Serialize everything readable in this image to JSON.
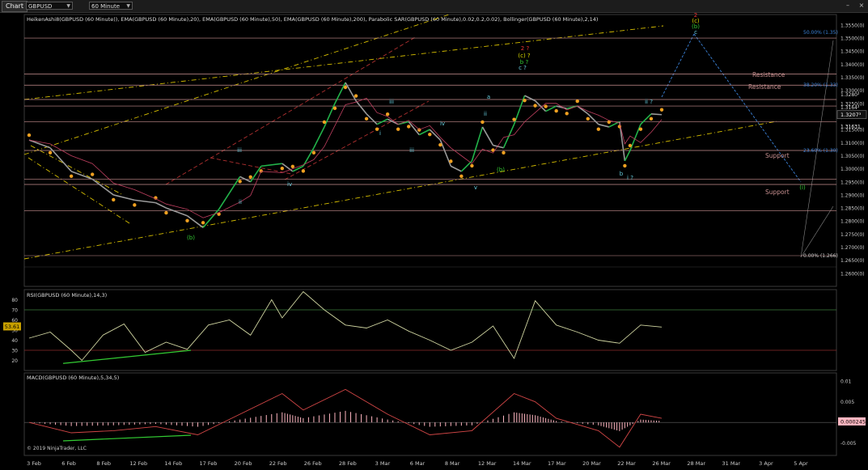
{
  "toolbar": {
    "chart_tab": "Chart",
    "instrument": "GBPUSD",
    "timeframe": "60 Minute"
  },
  "chart_data": [
    {
      "type": "line",
      "panel": "price",
      "title": "HeikenAshi8(GBPUSD (60 Minute)), EMA(GBPUSD (60 Minute),20), EMA(GBPUSD (60 Minute),50), EMA(GBPUSD (60 Minute),200), Parabolic SAR(GBPUSD (60 Minute),0.02,0.2,0.02), Bollinger(GBPUSD (60 Minute),2,14)",
      "ylim": [
        1.255,
        1.359
      ],
      "y_ticks": [
        "1.3550(0)",
        "1.3500(0)",
        "1.3450(0)",
        "1.3400(0)",
        "1.3350(0)",
        "1.3300(0)",
        "1.3250(0)",
        "1.3200(0)",
        "1.3150(0)",
        "1.3100(0)",
        "1.3050(0)",
        "1.3000(0)",
        "1.2950(0)",
        "1.2900(0)",
        "1.2850(0)",
        "1.2800(0)",
        "1.2750(0)",
        "1.2700(0)",
        "1.2650(0)",
        "1.2600(0)"
      ],
      "price_series": [
        [
          0,
          1.311
        ],
        [
          2,
          1.308
        ],
        [
          4,
          1.299
        ],
        [
          6,
          1.296
        ],
        [
          8,
          1.29
        ],
        [
          10,
          1.288
        ],
        [
          12,
          1.287
        ],
        [
          13,
          1.285
        ],
        [
          15,
          1.282
        ],
        [
          16.5,
          1.2775
        ],
        [
          18,
          1.2845
        ],
        [
          20,
          1.297
        ],
        [
          21,
          1.295
        ],
        [
          22,
          1.301
        ],
        [
          24,
          1.302
        ],
        [
          25,
          1.299
        ],
        [
          26,
          1.301
        ],
        [
          27,
          1.308
        ],
        [
          28,
          1.316
        ],
        [
          29,
          1.325
        ],
        [
          30,
          1.333
        ],
        [
          31,
          1.326
        ],
        [
          32,
          1.321
        ],
        [
          33,
          1.317
        ],
        [
          34,
          1.319
        ],
        [
          35,
          1.317
        ],
        [
          36,
          1.318
        ],
        [
          37,
          1.313
        ],
        [
          38,
          1.315
        ],
        [
          39,
          1.311
        ],
        [
          40,
          1.301
        ],
        [
          41,
          1.299
        ],
        [
          42,
          1.303
        ],
        [
          43,
          1.316
        ],
        [
          44,
          1.309
        ],
        [
          45,
          1.308
        ],
        [
          46,
          1.317
        ],
        [
          47,
          1.328
        ],
        [
          48,
          1.326
        ],
        [
          49,
          1.322
        ],
        [
          50,
          1.324
        ],
        [
          51,
          1.323
        ],
        [
          52,
          1.324
        ],
        [
          53,
          1.321
        ],
        [
          54,
          1.317
        ],
        [
          55,
          1.316
        ],
        [
          56,
          1.318
        ],
        [
          56.5,
          1.303
        ],
        [
          57,
          1.307
        ],
        [
          58,
          1.317
        ],
        [
          59,
          1.321
        ],
        [
          60,
          1.3207
        ]
      ],
      "current_price": "1.3207",
      "price_labels": [
        "1.3207³",
        "1.31631",
        "1.3280²",
        "1.3164²"
      ],
      "horizontal_levels": [
        {
          "label": "Resistance",
          "value": 1.336
        },
        {
          "label": "Resistance",
          "value": 1.333
        },
        {
          "label": "Support",
          "value": 1.3065
        },
        {
          "label": "Support",
          "value": 1.2955
        }
      ],
      "fib_labels": [
        "50.00% (1.35)",
        "38.20% (1.33)",
        "23.60% (1.30)",
        "0.00% (1.266)"
      ],
      "wave_labels": [
        "(b)",
        "iv",
        "iii",
        "ii",
        "i",
        "iii",
        "iv",
        "v",
        "a",
        "(b)",
        "2 ?",
        "(c) ?",
        "b ?",
        "c ?",
        "ii ?",
        "b",
        "i ?",
        "(i)",
        "2",
        "(c)",
        "(b)",
        "c",
        "iii",
        "ii"
      ],
      "x_tick_labels": [
        "3 Feb",
        "6 Feb",
        "8 Feb",
        "12 Feb",
        "14 Feb",
        "17 Feb",
        "20 Feb",
        "22 Feb",
        "26 Feb",
        "28 Feb",
        "3 Mar",
        "6 Mar",
        "8 Mar",
        "12 Mar",
        "14 Mar",
        "17 Mar",
        "20 Mar",
        "22 Mar",
        "26 Mar",
        "28 Mar",
        "31 Mar",
        "3 Apr",
        "5 Apr"
      ]
    },
    {
      "type": "line",
      "panel": "rsi",
      "title": "RSI(GBPUSD (60 Minute),14,3)",
      "ylim": [
        10,
        90
      ],
      "y_ticks": [
        "80",
        "70",
        "60",
        "50",
        "40",
        "30",
        "20"
      ],
      "overbought": 70,
      "oversold": 30,
      "current_value": "53.61",
      "values": [
        [
          0,
          42
        ],
        [
          2,
          48
        ],
        [
          4,
          30
        ],
        [
          5,
          20
        ],
        [
          7,
          45
        ],
        [
          9,
          56
        ],
        [
          11,
          28
        ],
        [
          13,
          38
        ],
        [
          15,
          31
        ],
        [
          17,
          55
        ],
        [
          19,
          60
        ],
        [
          21,
          45
        ],
        [
          23,
          80
        ],
        [
          24,
          62
        ],
        [
          26,
          88
        ],
        [
          28,
          70
        ],
        [
          30,
          55
        ],
        [
          32,
          52
        ],
        [
          34,
          60
        ],
        [
          36,
          49
        ],
        [
          38,
          40
        ],
        [
          40,
          30
        ],
        [
          42,
          38
        ],
        [
          44,
          54
        ],
        [
          46,
          22
        ],
        [
          48,
          79
        ],
        [
          50,
          55
        ],
        [
          52,
          48
        ],
        [
          54,
          40
        ],
        [
          56,
          37
        ],
        [
          58,
          55
        ],
        [
          60,
          53
        ]
      ]
    },
    {
      "type": "line",
      "panel": "macd",
      "title": "MACD(GBPUSD (60 Minute),5,34,5)",
      "ylim": [
        -0.008,
        0.012
      ],
      "y_ticks": [
        "0.01",
        "0.005",
        "0",
        "-0.005"
      ],
      "current_value": "0.000245",
      "values": [
        [
          0,
          0.0
        ],
        [
          4,
          -0.0025
        ],
        [
          8,
          -0.002
        ],
        [
          12,
          -0.001
        ],
        [
          16,
          -0.003
        ],
        [
          20,
          0.002
        ],
        [
          24,
          0.007
        ],
        [
          26,
          0.003
        ],
        [
          30,
          0.008
        ],
        [
          34,
          0.002
        ],
        [
          38,
          -0.003
        ],
        [
          42,
          -0.002
        ],
        [
          46,
          0.007
        ],
        [
          48,
          0.005
        ],
        [
          50,
          0.001
        ],
        [
          54,
          -0.002
        ],
        [
          56,
          -0.006
        ],
        [
          58,
          0.002
        ],
        [
          60,
          0.001
        ]
      ]
    }
  ],
  "copyright": "© 2019 NinjaTrader, LLC",
  "colors": {
    "background": "#000000",
    "heiken_up": "#22b34a",
    "heiken_down": "#9a9a9a",
    "sar": "#f0a020",
    "trend_yellow": "#d8c000",
    "trend_red": "#b03030",
    "resistance": "#c89090",
    "projection": "#3b82d8",
    "rsi_line": "#cfd4a0",
    "macd_line": "#d24646",
    "macd_hist": "#ffb6c1"
  }
}
